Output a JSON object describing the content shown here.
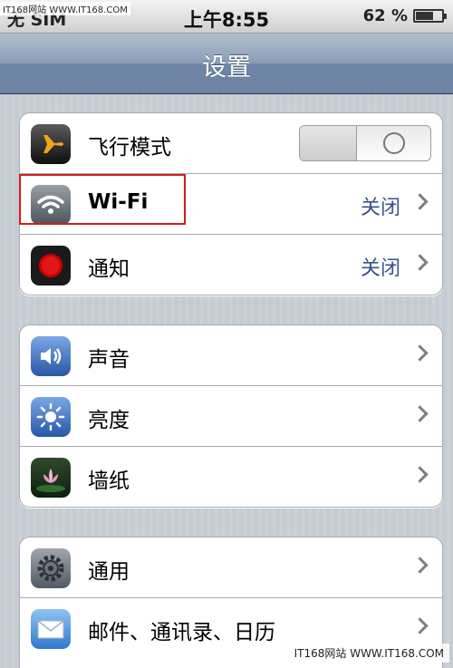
{
  "status_bar": {
    "carrier": "无 SIM",
    "carrier_watermark": "IT168网站 WWW.IT168.COM",
    "time": "上午8:55",
    "battery_percent": "62 %",
    "battery_level": 0.62
  },
  "nav": {
    "title": "设置"
  },
  "groups": [
    {
      "rows": [
        {
          "label": "飞行模式",
          "icon": "airplane-icon",
          "toggle_state": "O"
        },
        {
          "label": "Wi-Fi",
          "icon": "wifi-icon",
          "value": "关闭"
        },
        {
          "label": "通知",
          "icon": "notifications-icon",
          "value": "关闭"
        }
      ]
    },
    {
      "rows": [
        {
          "label": "声音",
          "icon": "sound-icon"
        },
        {
          "label": "亮度",
          "icon": "brightness-icon"
        },
        {
          "label": "墙纸",
          "icon": "wallpaper-icon"
        }
      ]
    },
    {
      "rows": [
        {
          "label": "通用",
          "icon": "general-icon"
        },
        {
          "label": "邮件、通讯录、日历",
          "icon": "mail-icon"
        }
      ]
    }
  ],
  "watermark": "IT168网站 WWW.IT168.COM",
  "colors": {
    "highlight": "#d21f1f",
    "value_text": "#385487",
    "nav_bar": "#6d84a4"
  }
}
